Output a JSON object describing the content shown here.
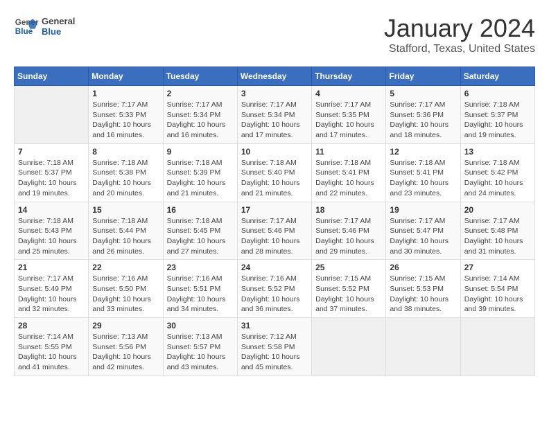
{
  "app": {
    "name": "General",
    "name2": "Blue"
  },
  "title": "January 2024",
  "location": "Stafford, Texas, United States",
  "days_of_week": [
    "Sunday",
    "Monday",
    "Tuesday",
    "Wednesday",
    "Thursday",
    "Friday",
    "Saturday"
  ],
  "weeks": [
    [
      {
        "day": "",
        "info": ""
      },
      {
        "day": "1",
        "info": "Sunrise: 7:17 AM\nSunset: 5:33 PM\nDaylight: 10 hours\nand 16 minutes."
      },
      {
        "day": "2",
        "info": "Sunrise: 7:17 AM\nSunset: 5:34 PM\nDaylight: 10 hours\nand 16 minutes."
      },
      {
        "day": "3",
        "info": "Sunrise: 7:17 AM\nSunset: 5:34 PM\nDaylight: 10 hours\nand 17 minutes."
      },
      {
        "day": "4",
        "info": "Sunrise: 7:17 AM\nSunset: 5:35 PM\nDaylight: 10 hours\nand 17 minutes."
      },
      {
        "day": "5",
        "info": "Sunrise: 7:17 AM\nSunset: 5:36 PM\nDaylight: 10 hours\nand 18 minutes."
      },
      {
        "day": "6",
        "info": "Sunrise: 7:18 AM\nSunset: 5:37 PM\nDaylight: 10 hours\nand 19 minutes."
      }
    ],
    [
      {
        "day": "7",
        "info": "Sunrise: 7:18 AM\nSunset: 5:37 PM\nDaylight: 10 hours\nand 19 minutes."
      },
      {
        "day": "8",
        "info": "Sunrise: 7:18 AM\nSunset: 5:38 PM\nDaylight: 10 hours\nand 20 minutes."
      },
      {
        "day": "9",
        "info": "Sunrise: 7:18 AM\nSunset: 5:39 PM\nDaylight: 10 hours\nand 21 minutes."
      },
      {
        "day": "10",
        "info": "Sunrise: 7:18 AM\nSunset: 5:40 PM\nDaylight: 10 hours\nand 21 minutes."
      },
      {
        "day": "11",
        "info": "Sunrise: 7:18 AM\nSunset: 5:41 PM\nDaylight: 10 hours\nand 22 minutes."
      },
      {
        "day": "12",
        "info": "Sunrise: 7:18 AM\nSunset: 5:41 PM\nDaylight: 10 hours\nand 23 minutes."
      },
      {
        "day": "13",
        "info": "Sunrise: 7:18 AM\nSunset: 5:42 PM\nDaylight: 10 hours\nand 24 minutes."
      }
    ],
    [
      {
        "day": "14",
        "info": "Sunrise: 7:18 AM\nSunset: 5:43 PM\nDaylight: 10 hours\nand 25 minutes."
      },
      {
        "day": "15",
        "info": "Sunrise: 7:18 AM\nSunset: 5:44 PM\nDaylight: 10 hours\nand 26 minutes."
      },
      {
        "day": "16",
        "info": "Sunrise: 7:18 AM\nSunset: 5:45 PM\nDaylight: 10 hours\nand 27 minutes."
      },
      {
        "day": "17",
        "info": "Sunrise: 7:17 AM\nSunset: 5:46 PM\nDaylight: 10 hours\nand 28 minutes."
      },
      {
        "day": "18",
        "info": "Sunrise: 7:17 AM\nSunset: 5:46 PM\nDaylight: 10 hours\nand 29 minutes."
      },
      {
        "day": "19",
        "info": "Sunrise: 7:17 AM\nSunset: 5:47 PM\nDaylight: 10 hours\nand 30 minutes."
      },
      {
        "day": "20",
        "info": "Sunrise: 7:17 AM\nSunset: 5:48 PM\nDaylight: 10 hours\nand 31 minutes."
      }
    ],
    [
      {
        "day": "21",
        "info": "Sunrise: 7:17 AM\nSunset: 5:49 PM\nDaylight: 10 hours\nand 32 minutes."
      },
      {
        "day": "22",
        "info": "Sunrise: 7:16 AM\nSunset: 5:50 PM\nDaylight: 10 hours\nand 33 minutes."
      },
      {
        "day": "23",
        "info": "Sunrise: 7:16 AM\nSunset: 5:51 PM\nDaylight: 10 hours\nand 34 minutes."
      },
      {
        "day": "24",
        "info": "Sunrise: 7:16 AM\nSunset: 5:52 PM\nDaylight: 10 hours\nand 36 minutes."
      },
      {
        "day": "25",
        "info": "Sunrise: 7:15 AM\nSunset: 5:52 PM\nDaylight: 10 hours\nand 37 minutes."
      },
      {
        "day": "26",
        "info": "Sunrise: 7:15 AM\nSunset: 5:53 PM\nDaylight: 10 hours\nand 38 minutes."
      },
      {
        "day": "27",
        "info": "Sunrise: 7:14 AM\nSunset: 5:54 PM\nDaylight: 10 hours\nand 39 minutes."
      }
    ],
    [
      {
        "day": "28",
        "info": "Sunrise: 7:14 AM\nSunset: 5:55 PM\nDaylight: 10 hours\nand 41 minutes."
      },
      {
        "day": "29",
        "info": "Sunrise: 7:13 AM\nSunset: 5:56 PM\nDaylight: 10 hours\nand 42 minutes."
      },
      {
        "day": "30",
        "info": "Sunrise: 7:13 AM\nSunset: 5:57 PM\nDaylight: 10 hours\nand 43 minutes."
      },
      {
        "day": "31",
        "info": "Sunrise: 7:12 AM\nSunset: 5:58 PM\nDaylight: 10 hours\nand 45 minutes."
      },
      {
        "day": "",
        "info": ""
      },
      {
        "day": "",
        "info": ""
      },
      {
        "day": "",
        "info": ""
      }
    ]
  ]
}
